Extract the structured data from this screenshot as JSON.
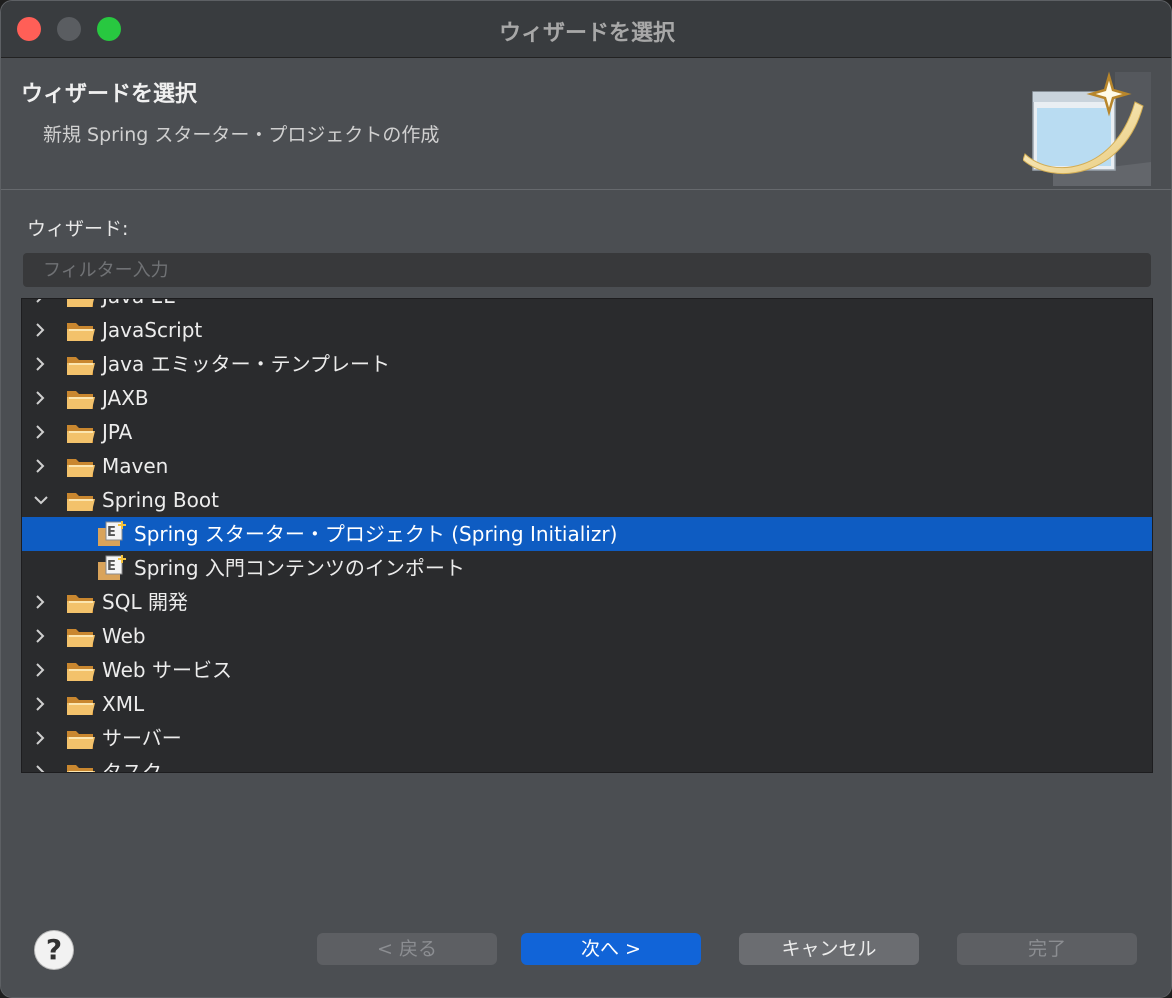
{
  "window": {
    "title": "ウィザードを選択"
  },
  "banner": {
    "title": "ウィザードを選択",
    "description": "新規 Spring スターター・プロジェクトの作成"
  },
  "content": {
    "wizards_label": "ウィザード:",
    "filter_placeholder": "フィルター入力",
    "filter_value": ""
  },
  "tree": {
    "items": [
      {
        "label": "Java EE",
        "type": "folder",
        "expanded": false,
        "selected": false,
        "partial": true
      },
      {
        "label": "JavaScript",
        "type": "folder",
        "expanded": false,
        "selected": false
      },
      {
        "label": "Java エミッター・テンプレート",
        "type": "folder",
        "expanded": false,
        "selected": false
      },
      {
        "label": "JAXB",
        "type": "folder",
        "expanded": false,
        "selected": false
      },
      {
        "label": "JPA",
        "type": "folder",
        "expanded": false,
        "selected": false
      },
      {
        "label": "Maven",
        "type": "folder",
        "expanded": false,
        "selected": false
      },
      {
        "label": "Spring Boot",
        "type": "folder",
        "expanded": true,
        "selected": false
      },
      {
        "label": "Spring スターター・プロジェクト (Spring Initializr)",
        "type": "wizard",
        "selected": true
      },
      {
        "label": "Spring 入門コンテンツのインポート",
        "type": "wizard",
        "selected": false
      },
      {
        "label": "SQL 開発",
        "type": "folder",
        "expanded": false,
        "selected": false
      },
      {
        "label": "Web",
        "type": "folder",
        "expanded": false,
        "selected": false
      },
      {
        "label": "Web サービス",
        "type": "folder",
        "expanded": false,
        "selected": false
      },
      {
        "label": "XML",
        "type": "folder",
        "expanded": false,
        "selected": false
      },
      {
        "label": "サーバー",
        "type": "folder",
        "expanded": false,
        "selected": false
      },
      {
        "label": "タスク",
        "type": "folder",
        "expanded": false,
        "selected": false,
        "partial": true
      }
    ]
  },
  "footer": {
    "help_label": "?",
    "back_label": "< 戻る",
    "next_label": "次へ >",
    "cancel_label": "キャンセル",
    "finish_label": "完了"
  },
  "icons": {
    "folder": "folder-icon",
    "wizard": "spring-project-icon",
    "collapsed": "chevron-right-icon",
    "expanded": "chevron-down-icon",
    "help": "help-icon"
  },
  "colors": {
    "selection": "#0e5cc2",
    "primary_button": "#1164d8",
    "close": "#ff5f57",
    "maximize": "#28c840"
  }
}
